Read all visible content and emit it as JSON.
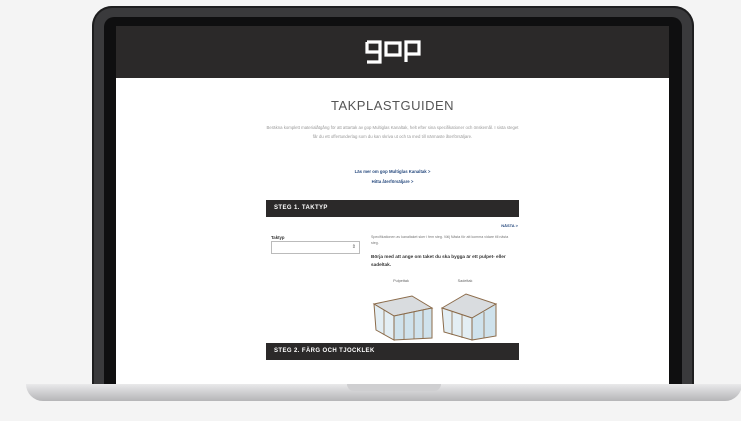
{
  "page": {
    "title": "TAKPLASTGUIDEN",
    "intro": "Beräkna komplett materialåtgång för att attartak av gop Multiglas Kanaltak, helt efter sina specifikationer och önskemål. I sista steget får du ett offertunderlag som du kan skriva ut och ta med till närmaste återförsäljare.",
    "link_read_more": "Läs mer om gop Multiglas Kanaltak  >",
    "link_dealer": "Hitta återförsäljare  >"
  },
  "step1": {
    "heading": "STEG 1. TAKTYP",
    "next": "NÄSTA >",
    "field_label": "Taktyp",
    "select_value": "",
    "select_arrow": "⇕",
    "description": "Specifikationen av kanaltaket sker i fem steg. Välj Nästa för att komma vidare till nästa steg.",
    "hint": "Börja med att ange om taket du ska bygga är ett pulpet- eller sadeltak.",
    "options": [
      {
        "label": "Pulpettak"
      },
      {
        "label": "Sadeltak"
      }
    ]
  },
  "step2": {
    "heading": "STEG 2. FÄRG OCH TJOCKLEK"
  }
}
